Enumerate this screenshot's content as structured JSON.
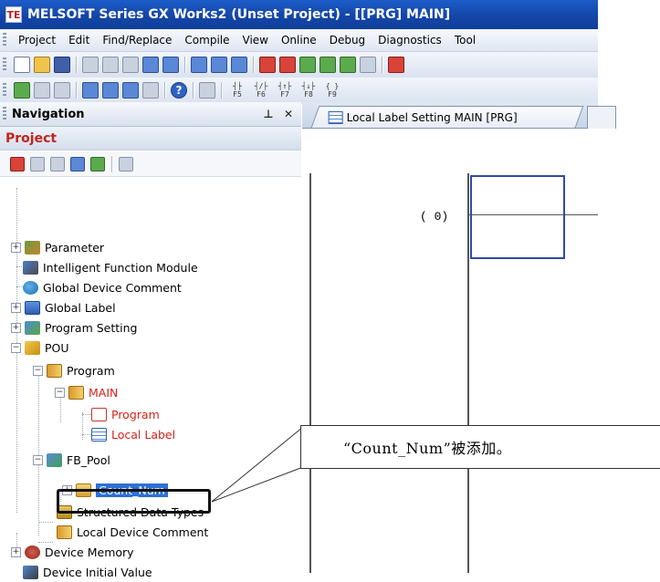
{
  "window": {
    "title": "MELSOFT Series GX Works2 (Unset Project) - [[PRG] MAIN]",
    "logo_text": "TE"
  },
  "menu": [
    {
      "label": "Project"
    },
    {
      "label": "Edit"
    },
    {
      "label": "Find/Replace"
    },
    {
      "label": "Compile"
    },
    {
      "label": "View"
    },
    {
      "label": "Online"
    },
    {
      "label": "Debug"
    },
    {
      "label": "Diagnostics"
    },
    {
      "label": "Tool"
    }
  ],
  "navigation": {
    "title": "Navigation",
    "pin_glyph": "⊥",
    "close_glyph": "✕",
    "project_label": "Project",
    "tree": [
      {
        "label": "Parameter"
      },
      {
        "label": "Intelligent Function Module"
      },
      {
        "label": "Global Device Comment"
      },
      {
        "label": "Global Label"
      },
      {
        "label": "Program Setting"
      },
      {
        "label": "POU"
      },
      {
        "label": "Program"
      },
      {
        "label": "MAIN"
      },
      {
        "label": "Program"
      },
      {
        "label": "Local Label"
      },
      {
        "label": "FB_Pool"
      },
      {
        "label": "Count_Num"
      },
      {
        "label": "Structured Data Types"
      },
      {
        "label": "Local Device Comment"
      },
      {
        "label": "Device Memory"
      },
      {
        "label": "Device Initial Value"
      }
    ]
  },
  "editor": {
    "tab_label": "Local Label Setting MAIN [PRG]",
    "step_label": "(   0)"
  },
  "callout": {
    "text": "“Count_Num”被添加。"
  },
  "colors": {
    "title_bar": "#1446a8",
    "selected": "#2d6fd6",
    "red_text": "#d8201a",
    "cursor": "#3049a8"
  },
  "toolbar_glyphs": {
    "ladder_symbols": [
      "┤├ F5",
      "┤/├ F6",
      "┤↑├ F7",
      "┤↓├ F8",
      "{ } F9"
    ]
  }
}
